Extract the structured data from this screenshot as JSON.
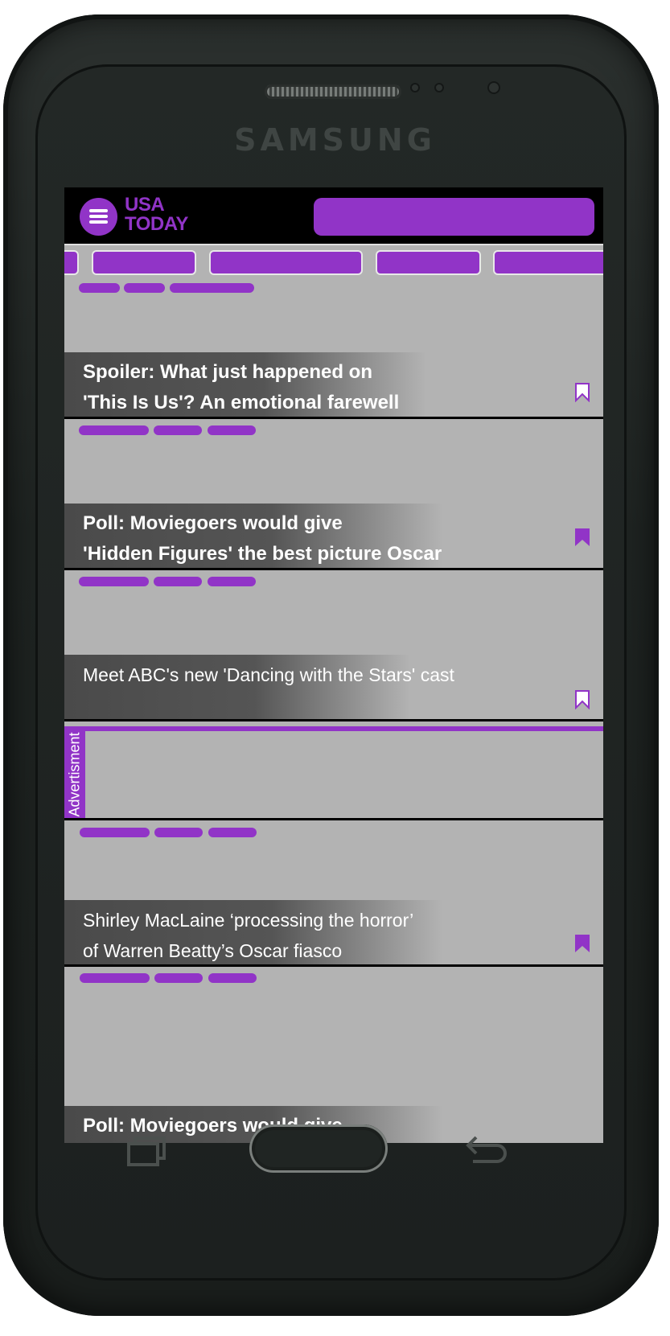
{
  "device": {
    "brand": "SAMSUNG"
  },
  "app": {
    "logo_line1": "USA",
    "logo_line2": "TODAY",
    "accent": "#9134c7"
  },
  "articles": [
    {
      "headline_line1": "Spoiler: What just happened on",
      "headline_line2": "'This Is Us'? An emotional farewell",
      "bookmarked": false
    },
    {
      "headline_line1": "Poll: Moviegoers would give",
      "headline_line2": "'Hidden Figures' the best picture Oscar",
      "bookmarked": true
    },
    {
      "headline_line1": "Meet ABC's new 'Dancing with the Stars' cast",
      "headline_line2": "",
      "bookmarked": false
    },
    {
      "headline_line1": "Shirley MacLaine ‘processing the horror’",
      "headline_line2": "of Warren Beatty’s Oscar fiasco",
      "bookmarked": true
    },
    {
      "headline_line1": "Poll: Moviegoers would give",
      "headline_line2": "",
      "bookmarked": false
    }
  ],
  "ad": {
    "label": "Advertisment"
  },
  "icons": {
    "menu": "hamburger-menu-icon",
    "bookmark": "bookmark-icon",
    "recent": "recent-apps-icon",
    "back": "back-icon"
  }
}
